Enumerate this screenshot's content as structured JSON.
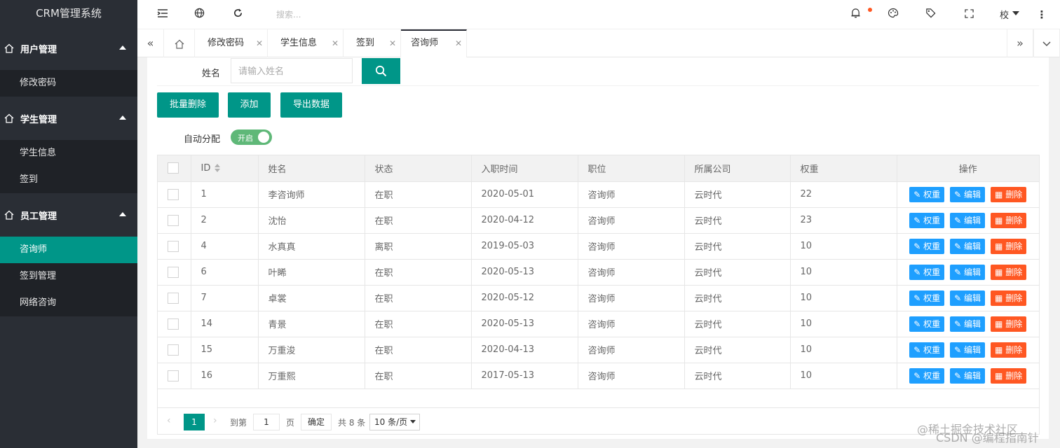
{
  "app": {
    "title": "CRM管理系统"
  },
  "sidebar": {
    "groups": [
      {
        "label": "用户管理",
        "items": [
          "修改密码"
        ]
      },
      {
        "label": "学生管理",
        "items": [
          "学生信息",
          "签到"
        ]
      },
      {
        "label": "员工管理",
        "items": [
          "咨询师",
          "签到管理",
          "网络咨询"
        ]
      }
    ],
    "active_item": "咨询师"
  },
  "header": {
    "search_placeholder": "搜索...",
    "user": "校",
    "icons": [
      "menu-toggle-icon",
      "globe-icon",
      "refresh-icon",
      "bell-icon",
      "palette-icon",
      "tag-icon",
      "fullscreen-icon",
      "more-icon"
    ]
  },
  "tabs": {
    "items": [
      "修改密码",
      "学生信息",
      "签到",
      "咨询师"
    ],
    "active": "咨询师"
  },
  "form": {
    "name_label": "姓名",
    "name_placeholder": "请输入姓名",
    "name_value": ""
  },
  "actions": {
    "batch_delete": "批量删除",
    "add": "添加",
    "export": "导出数据"
  },
  "auto_assign": {
    "label": "自动分配",
    "switch_text": "开启",
    "on": true
  },
  "table": {
    "columns": [
      "ID",
      "姓名",
      "状态",
      "入职时间",
      "职位",
      "所属公司",
      "权重",
      "操作"
    ],
    "rows": [
      {
        "id": "1",
        "name": "李咨询师",
        "status": "在职",
        "date": "2020-05-01",
        "position": "咨询师",
        "company": "云时代",
        "weight": "22"
      },
      {
        "id": "2",
        "name": "沈怡",
        "status": "在职",
        "date": "2020-04-12",
        "position": "咨询师",
        "company": "云时代",
        "weight": "23"
      },
      {
        "id": "4",
        "name": "水真真",
        "status": "离职",
        "date": "2019-05-03",
        "position": "咨询师",
        "company": "云时代",
        "weight": "10"
      },
      {
        "id": "6",
        "name": "叶睎",
        "status": "在职",
        "date": "2020-05-13",
        "position": "咨询师",
        "company": "云时代",
        "weight": "10"
      },
      {
        "id": "7",
        "name": "卓裳",
        "status": "在职",
        "date": "2020-05-12",
        "position": "咨询师",
        "company": "云时代",
        "weight": "10"
      },
      {
        "id": "14",
        "name": "青景",
        "status": "在职",
        "date": "2020-05-13",
        "position": "咨询师",
        "company": "云时代",
        "weight": "10"
      },
      {
        "id": "15",
        "name": "万重浚",
        "status": "在职",
        "date": "2020-04-13",
        "position": "咨询师",
        "company": "云时代",
        "weight": "10"
      },
      {
        "id": "16",
        "name": "万重熙",
        "status": "在职",
        "date": "2017-05-13",
        "position": "咨询师",
        "company": "云时代",
        "weight": "10"
      }
    ],
    "row_actions": {
      "weight": "权重",
      "edit": "编辑",
      "delete": "删除"
    }
  },
  "pager": {
    "current": "1",
    "goto_label": "到第",
    "goto_value": "1",
    "page_unit": "页",
    "confirm": "确定",
    "total": "共 8 条",
    "page_size": "10 条/页"
  },
  "watermark": {
    "line1": "@稀土掘金技术社区",
    "line2": "CSDN @编程指南针"
  },
  "colors": {
    "primary": "#009688",
    "sidebar": "#2a2e35",
    "blue": "#1e9fff",
    "red": "#ff5722",
    "switch_on": "#5fb878"
  }
}
